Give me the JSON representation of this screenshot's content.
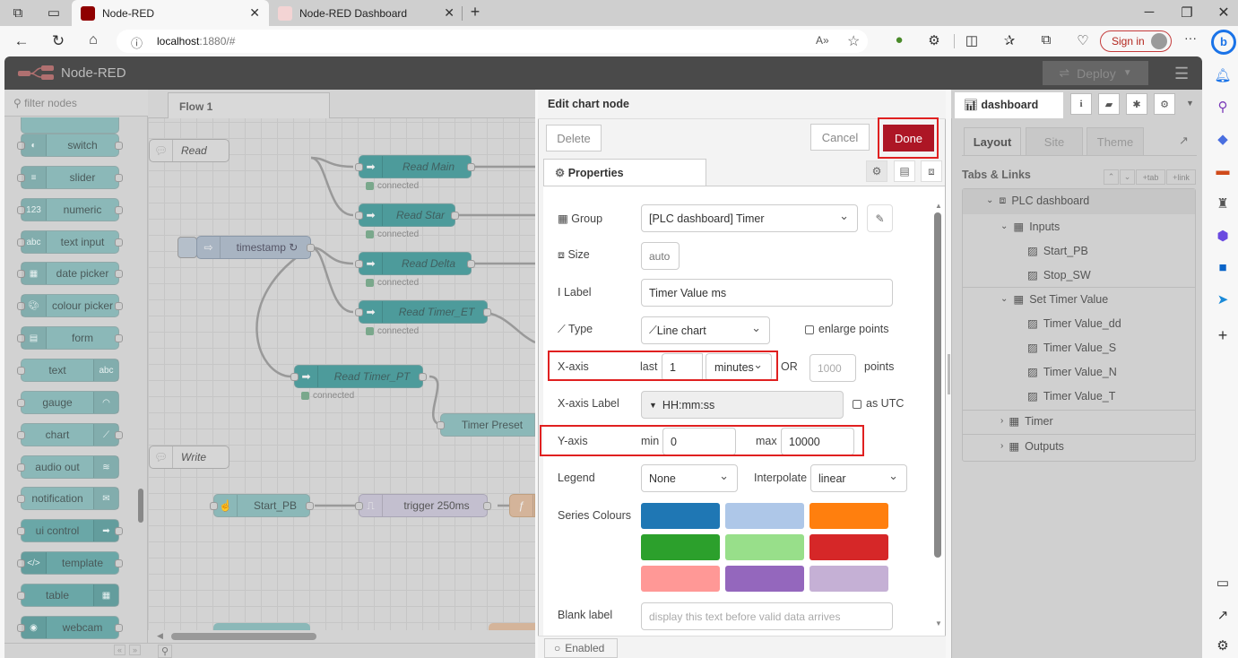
{
  "browser": {
    "tabs": [
      {
        "title": "Node-RED",
        "active": true
      },
      {
        "title": "Node-RED Dashboard",
        "active": false
      }
    ],
    "url_host": "localhost",
    "url_rest": ":1880/#",
    "signin_label": "Sign in",
    "more_label": "···"
  },
  "app": {
    "title": "Node-RED",
    "deploy_label": "Deploy"
  },
  "palette": {
    "filter_placeholder": "filter nodes",
    "nodes": [
      {
        "label": "switch",
        "icon": "toggle-icon"
      },
      {
        "label": "slider",
        "icon": "slider-icon"
      },
      {
        "label": "numeric",
        "icon": "numeric-icon"
      },
      {
        "label": "text input",
        "icon": "text-input-icon"
      },
      {
        "label": "date picker",
        "icon": "calendar-icon"
      },
      {
        "label": "colour picker",
        "icon": "palette-icon"
      },
      {
        "label": "form",
        "icon": "form-icon"
      },
      {
        "label": "text",
        "icon": "abc-icon"
      },
      {
        "label": "gauge",
        "icon": "gauge-icon"
      },
      {
        "label": "chart",
        "icon": "chart-icon"
      },
      {
        "label": "audio out",
        "icon": "audio-icon"
      },
      {
        "label": "notification",
        "icon": "envelope-icon"
      },
      {
        "label": "ui control",
        "icon": "arrow-icon"
      },
      {
        "label": "template",
        "icon": "code-icon"
      },
      {
        "label": "table",
        "icon": "table-icon"
      },
      {
        "label": "webcam",
        "icon": "camera-icon"
      }
    ]
  },
  "workspace": {
    "flow_tab": "Flow 1",
    "comments": [
      "Read",
      "Write"
    ],
    "nodes": {
      "timestamp": "timestamp ↻",
      "read_main": "Read Main",
      "read_star": "Read Star",
      "read_delta": "Read Delta",
      "read_timer_et": "Read Timer_ET",
      "read_timer_pt": "Read Timer_PT",
      "timer_preset": "Timer Preset",
      "start_pb": "Start_PB",
      "trigger": "trigger 250ms"
    },
    "status_text": "connected"
  },
  "dialog": {
    "title": "Edit chart node",
    "delete_label": "Delete",
    "cancel_label": "Cancel",
    "done_label": "Done",
    "properties_tab": "Properties",
    "group": {
      "label": "Group",
      "value": "[PLC dashboard] Timer"
    },
    "size": {
      "label": "Size",
      "value": "auto"
    },
    "label": {
      "label": "Label",
      "value": "Timer Value ms"
    },
    "type": {
      "label": "Type",
      "value": "Line chart",
      "enlarge_label": "enlarge points",
      "enlarge_checked": false
    },
    "xaxis": {
      "label": "X-axis",
      "last_label": "last",
      "last_value": "1",
      "unit": "minutes",
      "or_label": "OR",
      "points_placeholder": "1000",
      "points_label": "points"
    },
    "xaxis_label": {
      "label": "X-axis Label",
      "value": "HH:mm:ss",
      "utc_label": "as UTC",
      "utc_checked": false
    },
    "yaxis": {
      "label": "Y-axis",
      "min_label": "min",
      "min_value": "0",
      "max_label": "max",
      "max_value": "10000"
    },
    "legend": {
      "label": "Legend",
      "value": "None",
      "interpolate_label": "Interpolate",
      "interpolate_value": "linear"
    },
    "series_colours": {
      "label": "Series Colours",
      "colors": [
        "#1f77b4",
        "#aec7e8",
        "#ff7f0e",
        "#2ca02c",
        "#98df8a",
        "#d62728",
        "#ff9896",
        "#9467bd",
        "#c5b0d5"
      ]
    },
    "blank_label": {
      "label": "Blank label",
      "placeholder": "display this text before valid data arrives"
    },
    "enabled_label": "Enabled"
  },
  "sidebar": {
    "tab_label": "dashboard",
    "layout_tabs": [
      "Layout",
      "Site",
      "Theme"
    ],
    "section_title": "Tabs & Links",
    "buttons": [
      "+tab",
      "+link"
    ],
    "tree": [
      {
        "label": "PLC dashboard",
        "level": 0,
        "type": "tab",
        "expanded": true
      },
      {
        "label": "Inputs",
        "level": 1,
        "type": "group",
        "expanded": true
      },
      {
        "label": "Start_PB",
        "level": 2,
        "type": "widget"
      },
      {
        "label": "Stop_SW",
        "level": 2,
        "type": "widget"
      },
      {
        "label": "Set Timer Value",
        "level": 1,
        "type": "group",
        "expanded": true
      },
      {
        "label": "Timer Value_dd",
        "level": 2,
        "type": "widget"
      },
      {
        "label": "Timer Value_S",
        "level": 2,
        "type": "widget"
      },
      {
        "label": "Timer Value_N",
        "level": 2,
        "type": "widget"
      },
      {
        "label": "Timer Value_T",
        "level": 2,
        "type": "widget"
      },
      {
        "label": "Timer",
        "level": 1,
        "type": "group",
        "expanded": false
      },
      {
        "label": "Outputs",
        "level": 1,
        "type": "group",
        "expanded": false
      }
    ]
  }
}
